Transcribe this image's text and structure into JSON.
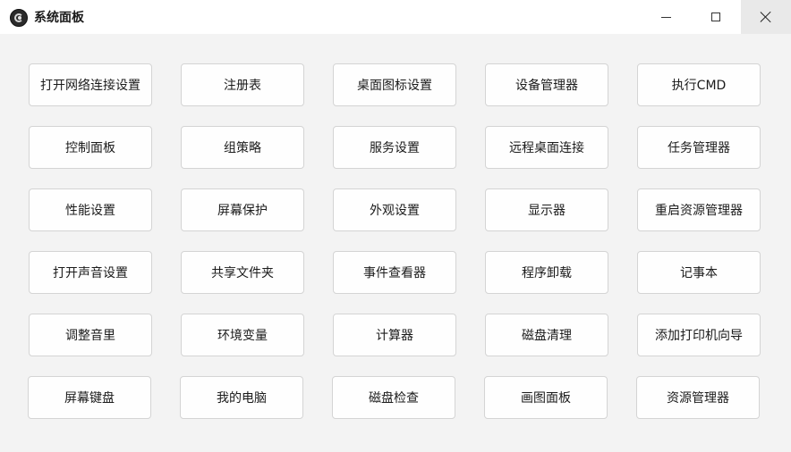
{
  "window": {
    "title": "系统面板",
    "controls": [
      "minimize",
      "maximize",
      "close"
    ]
  },
  "rows": [
    [
      "打开网络连接设置",
      "注册表",
      "桌面图标设置",
      "设备管理器",
      "执行CMD"
    ],
    [
      "控制面板",
      "组策略",
      "服务设置",
      "远程桌面连接",
      "任务管理器"
    ],
    [
      "性能设置",
      "屏幕保护",
      "外观设置",
      "显示器",
      "重启资源管理器"
    ],
    [
      "打开声音设置",
      "共享文件夹",
      "事件查看器",
      "程序卸载",
      "记事本"
    ],
    [
      "调整音里",
      "环境变量",
      "计算器",
      "磁盘清理",
      "添加打印机向导"
    ],
    [
      "屏幕键盘",
      "我的电脑",
      "磁盘检查",
      "画图面板",
      "资源管理器"
    ]
  ]
}
